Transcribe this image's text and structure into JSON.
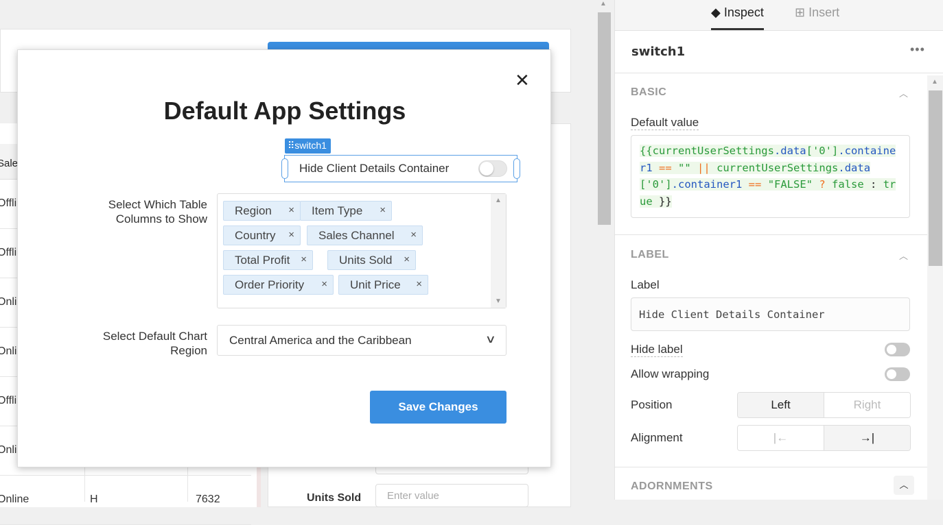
{
  "background": {
    "table_header_partial": "Sale",
    "table_rows": [
      {
        "channel": "Offli"
      },
      {
        "channel": "Offli"
      },
      {
        "channel": "Onli"
      },
      {
        "channel": "Onli"
      },
      {
        "channel": "Offli"
      },
      {
        "channel": "Onli"
      },
      {
        "channel": "Online",
        "priority": "H",
        "units": "7632"
      }
    ],
    "form_label": "Units Sold",
    "form_placeholder": "Enter value"
  },
  "modal": {
    "title": "Default App Settings",
    "close_icon": "close-icon",
    "switch_tag": "switch1",
    "switch_label": "Hide Client Details Container",
    "switch_on": false,
    "columns_label_1": "Select Which Table",
    "columns_label_2": "Columns to Show",
    "columns": [
      "Region",
      "Item Type",
      "Country",
      "Sales Channel",
      "Total Profit",
      "Units Sold",
      "Order Priority",
      "Unit Price"
    ],
    "chip_remove": "×",
    "region_label_1": "Select Default Chart",
    "region_label_2": "Region",
    "region_value": "Central America and the Caribbean",
    "save_label": "Save Changes",
    "accent": "#3a8ee0"
  },
  "inspector": {
    "tabs": [
      {
        "label": "Inspect",
        "icon": "layers-icon",
        "active": true
      },
      {
        "label": "Insert",
        "icon": "insert-icon",
        "active": false
      }
    ],
    "component": "switch1",
    "more": "•••",
    "basic": {
      "title": "BASIC",
      "default_value_label": "Default value",
      "code": [
        [
          "g",
          "{{currentUserSettings"
        ],
        [
          "b",
          ".data"
        ],
        [
          "g",
          "['0']"
        ],
        [
          "b",
          ".container1"
        ],
        [
          "k",
          " "
        ],
        [
          "o",
          "=="
        ],
        [
          "k",
          " "
        ],
        [
          "g",
          "\"\""
        ],
        [
          "k",
          " "
        ],
        [
          "o",
          "||"
        ],
        [
          "k",
          " "
        ],
        [
          "g",
          "currentUserSettings"
        ],
        [
          "b",
          ".data"
        ],
        [
          "g",
          "['0']"
        ],
        [
          "b",
          ".container1"
        ],
        [
          "k",
          " "
        ],
        [
          "o",
          "=="
        ],
        [
          "k",
          " "
        ],
        [
          "g",
          "\"FALSE\""
        ],
        [
          "k",
          " "
        ],
        [
          "o",
          "?"
        ],
        [
          "k",
          " "
        ],
        [
          "g",
          "false"
        ],
        [
          "k",
          " : "
        ],
        [
          "g",
          "true"
        ],
        [
          "k",
          " }}"
        ]
      ]
    },
    "label": {
      "title": "LABEL",
      "label_label": "Label",
      "label_value": "Hide Client Details Container",
      "hide_label": "Hide label",
      "hide_label_on": false,
      "allow_wrapping": "Allow wrapping",
      "allow_wrapping_on": false,
      "position_label": "Position",
      "position_options": [
        "Left",
        "Right"
      ],
      "position_selected": "Left",
      "alignment_label": "Alignment",
      "alignment_options": [
        "|←",
        "→|"
      ],
      "alignment_selected": "→|"
    },
    "adornments": {
      "title": "ADORNMENTS"
    }
  }
}
